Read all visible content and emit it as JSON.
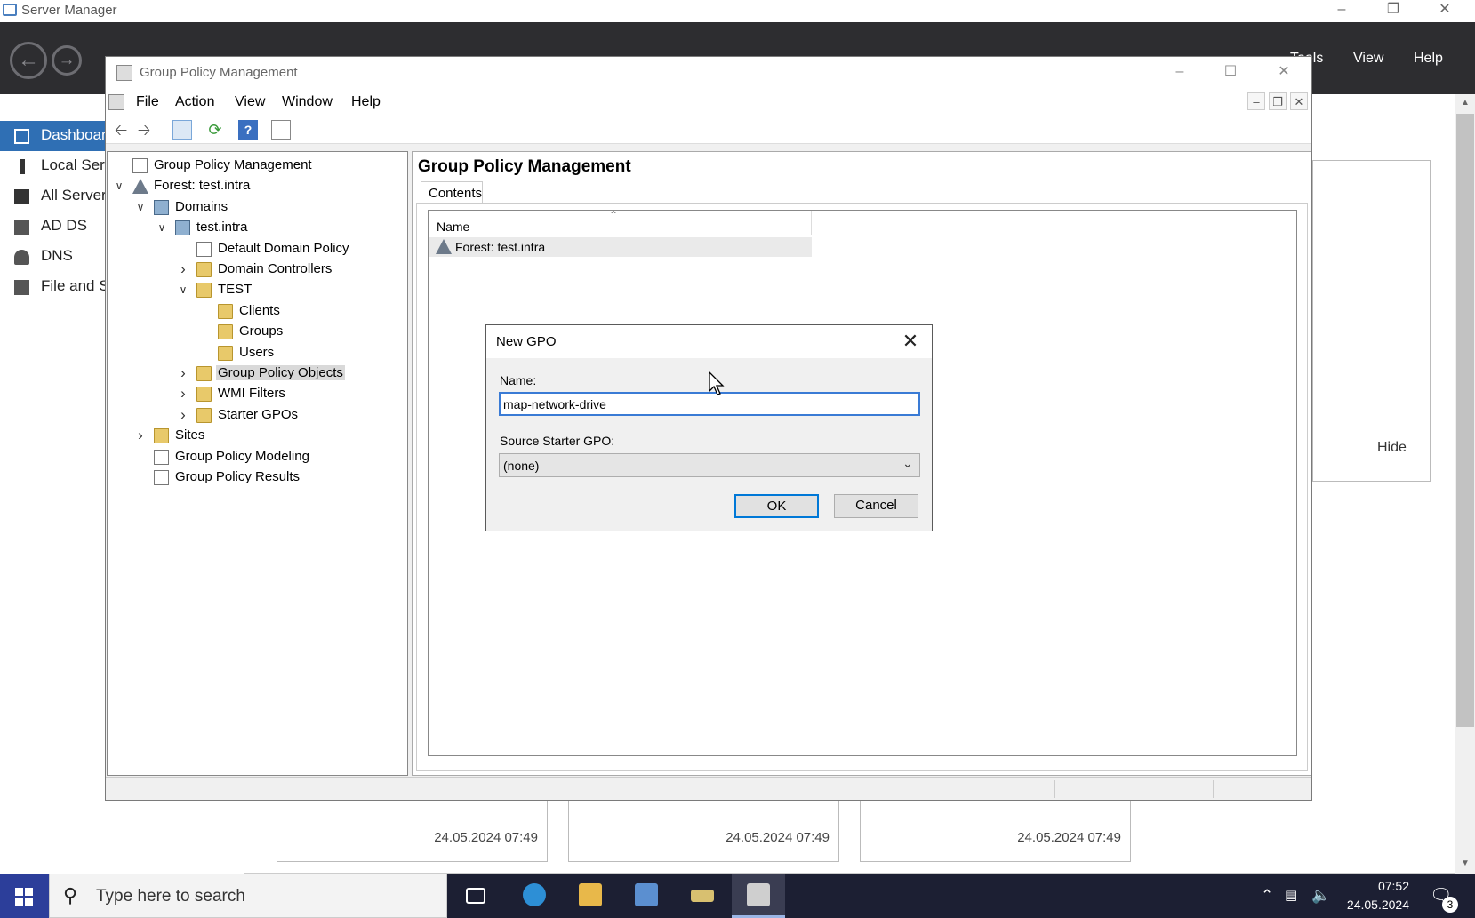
{
  "server_manager": {
    "window_title": "Server Manager",
    "header_menu": [
      "Tools",
      "View",
      "Help"
    ],
    "nav_items": [
      {
        "label": "Dashboard",
        "icon": "dashboard-icon"
      },
      {
        "label": "Local Server",
        "icon": "server-icon"
      },
      {
        "label": "All Servers",
        "icon": "servers-icon"
      },
      {
        "label": "AD DS",
        "icon": "ad-ds-icon"
      },
      {
        "label": "DNS",
        "icon": "dns-icon"
      },
      {
        "label": "File and Storage Services",
        "icon": "file-storage-icon"
      }
    ],
    "hide_label": "Hide",
    "tile_timestamps": [
      "24.05.2024 07:49",
      "24.05.2024 07:49",
      "24.05.2024 07:49"
    ]
  },
  "gpmc": {
    "window_title": "Group Policy Management",
    "menu": [
      "File",
      "Action",
      "View",
      "Window",
      "Help"
    ],
    "tree": [
      {
        "label": "Group Policy Management",
        "icon": "gpmc-root-icon",
        "depth": 0,
        "expander": ""
      },
      {
        "label": "Forest: test.intra",
        "icon": "forest-icon",
        "depth": 0,
        "expander": "expanded"
      },
      {
        "label": "Domains",
        "icon": "domains-icon",
        "depth": 1,
        "expander": "expanded"
      },
      {
        "label": "test.intra",
        "icon": "domain-icon",
        "depth": 2,
        "expander": "expanded"
      },
      {
        "label": "Default Domain Policy",
        "icon": "gpo-link-icon",
        "depth": 3,
        "expander": ""
      },
      {
        "label": "Domain Controllers",
        "icon": "ou-icon",
        "depth": 3,
        "expander": "collapsed"
      },
      {
        "label": "TEST",
        "icon": "ou-icon",
        "depth": 3,
        "expander": "expanded"
      },
      {
        "label": "Clients",
        "icon": "ou-icon",
        "depth": 4,
        "expander": ""
      },
      {
        "label": "Groups",
        "icon": "ou-icon",
        "depth": 4,
        "expander": ""
      },
      {
        "label": "Users",
        "icon": "ou-icon",
        "depth": 4,
        "expander": ""
      },
      {
        "label": "Group Policy Objects",
        "icon": "gpo-container-icon",
        "depth": 3,
        "expander": "collapsed",
        "selected": true
      },
      {
        "label": "WMI Filters",
        "icon": "wmi-filters-icon",
        "depth": 3,
        "expander": "collapsed"
      },
      {
        "label": "Starter GPOs",
        "icon": "starter-gpos-icon",
        "depth": 3,
        "expander": "collapsed"
      },
      {
        "label": "Sites",
        "icon": "sites-icon",
        "depth": 1,
        "expander": "collapsed"
      },
      {
        "label": "Group Policy Modeling",
        "icon": "modeling-icon",
        "depth": 1,
        "expander": ""
      },
      {
        "label": "Group Policy Results",
        "icon": "results-icon",
        "depth": 1,
        "expander": ""
      }
    ],
    "content": {
      "title": "Group Policy Management",
      "tab": "Contents",
      "column_name": "Name",
      "rows": [
        "Forest: test.intra"
      ]
    }
  },
  "dialog": {
    "title": "New GPO",
    "name_label": "Name:",
    "name_value": "map-network-drive",
    "source_label": "Source Starter GPO:",
    "source_value": "(none)",
    "ok_label": "OK",
    "cancel_label": "Cancel"
  },
  "taskbar": {
    "search_placeholder": "Type here to search",
    "time": "07:52",
    "date": "24.05.2024",
    "notification_count": "3"
  },
  "colors": {
    "sm_header": "#2d2d30",
    "sm_nav_active": "#2f6fb4",
    "focus_blue": "#0078d7",
    "taskbar": "#1c1f33"
  }
}
